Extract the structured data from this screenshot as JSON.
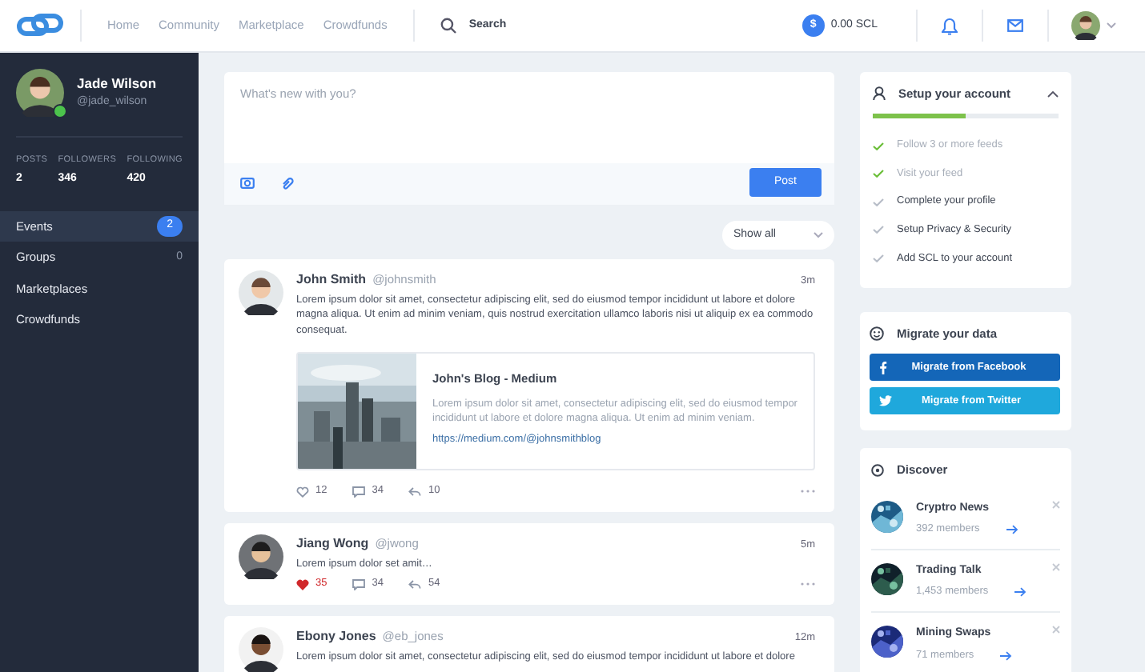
{
  "nav": {
    "links": [
      {
        "label": "Home"
      },
      {
        "label": "Community"
      },
      {
        "label": "Marketplace"
      },
      {
        "label": "Crowdfunds"
      }
    ],
    "search": "Search",
    "balance": {
      "symbol": "$",
      "amount": "0.00 SCL"
    }
  },
  "profile": {
    "name": "Jade Wilson",
    "handle": "@jade_wilson",
    "online": true,
    "stats": [
      {
        "label": "POSTS",
        "value": "2"
      },
      {
        "label": "FOLLOWERS",
        "value": "346"
      },
      {
        "label": "FOLLOWING",
        "value": "420"
      }
    ]
  },
  "sidebar": {
    "items": [
      {
        "label": "Events",
        "count": "2",
        "selected": true
      },
      {
        "label": "Groups",
        "count": "0",
        "selected": false
      },
      {
        "label": "Marketplaces",
        "selected": false
      },
      {
        "label": "Crowdfunds",
        "selected": false
      }
    ]
  },
  "composer": {
    "placeholder": "What's new with you?",
    "button": "Post"
  },
  "filter": {
    "label": "Show all"
  },
  "posts": [
    {
      "name": "John Smith",
      "handle": "@johnsmith",
      "time": "3m",
      "text": "Lorem ipsum dolor sit amet, consectetur adipiscing elit, sed do eiusmod tempor incididunt ut labore et dolore magna aliqua. Ut enim ad minim veniam, quis nostrud exercitation ullamco laboris nisi ut aliquip ex ea commodo consequat.",
      "preview": {
        "title": "John's Blog - Medium",
        "text": "Lorem ipsum dolor sit amet, consectetur adipiscing elit, sed do eiusmod tempor incididunt ut labore et dolore magna aliqua. Ut enim ad minim veniam.",
        "url": "https://medium.com/@johnsmithblog"
      },
      "likes": "12",
      "liked": false,
      "comments": "34",
      "shares": "10"
    },
    {
      "name": "Jiang Wong",
      "handle": "@jwong",
      "time": "5m",
      "text": "Lorem ipsum dolor set amit…",
      "likes": "35",
      "liked": true,
      "comments": "34",
      "shares": "54"
    },
    {
      "name": "Ebony Jones",
      "handle": "@eb_jones",
      "time": "12m",
      "text": "Lorem ipsum dolor sit amet, consectetur adipiscing elit, sed do eiusmod tempor incididunt ut labore et dolore"
    }
  ],
  "setup": {
    "title": "Setup your account",
    "expanded": true,
    "level": 0.5,
    "steps": [
      {
        "label": "Follow 3 or more feeds",
        "done": true
      },
      {
        "label": "Visit your feed",
        "done": true
      },
      {
        "label": "Complete your profile",
        "done": false
      },
      {
        "label": "Setup Privacy & Security",
        "done": false
      },
      {
        "label": "Add SCL to your account",
        "done": false
      }
    ]
  },
  "migrate": {
    "title": "Migrate your data",
    "buttons": [
      {
        "kind": "facebook",
        "label": "Migrate from Facebook"
      },
      {
        "kind": "twitter",
        "label": "Migrate from Twitter"
      }
    ]
  },
  "discover": {
    "title": "Discover",
    "groups": [
      {
        "name": "Cryptro News",
        "members": "392 members"
      },
      {
        "name": "Trading Talk",
        "members": "1,453 members"
      },
      {
        "name": "Mining Swaps",
        "members": "71 members"
      }
    ]
  }
}
